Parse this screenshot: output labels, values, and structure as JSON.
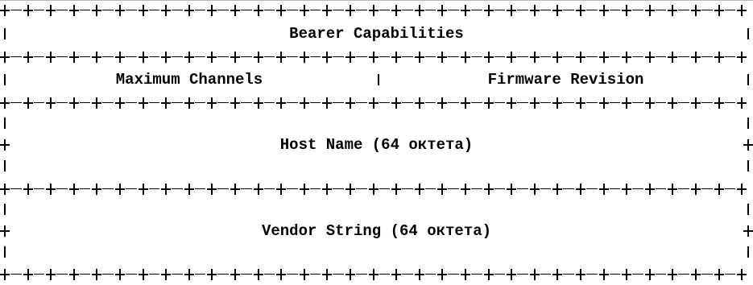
{
  "fields": {
    "bearer_capabilities": "Bearer Capabilities",
    "maximum_channels": "Maximum Channels",
    "firmware_revision": "Firmware Revision",
    "host_name": "Host Name (64 октета)",
    "vendor_string": "Vendor String (64 октета)"
  }
}
